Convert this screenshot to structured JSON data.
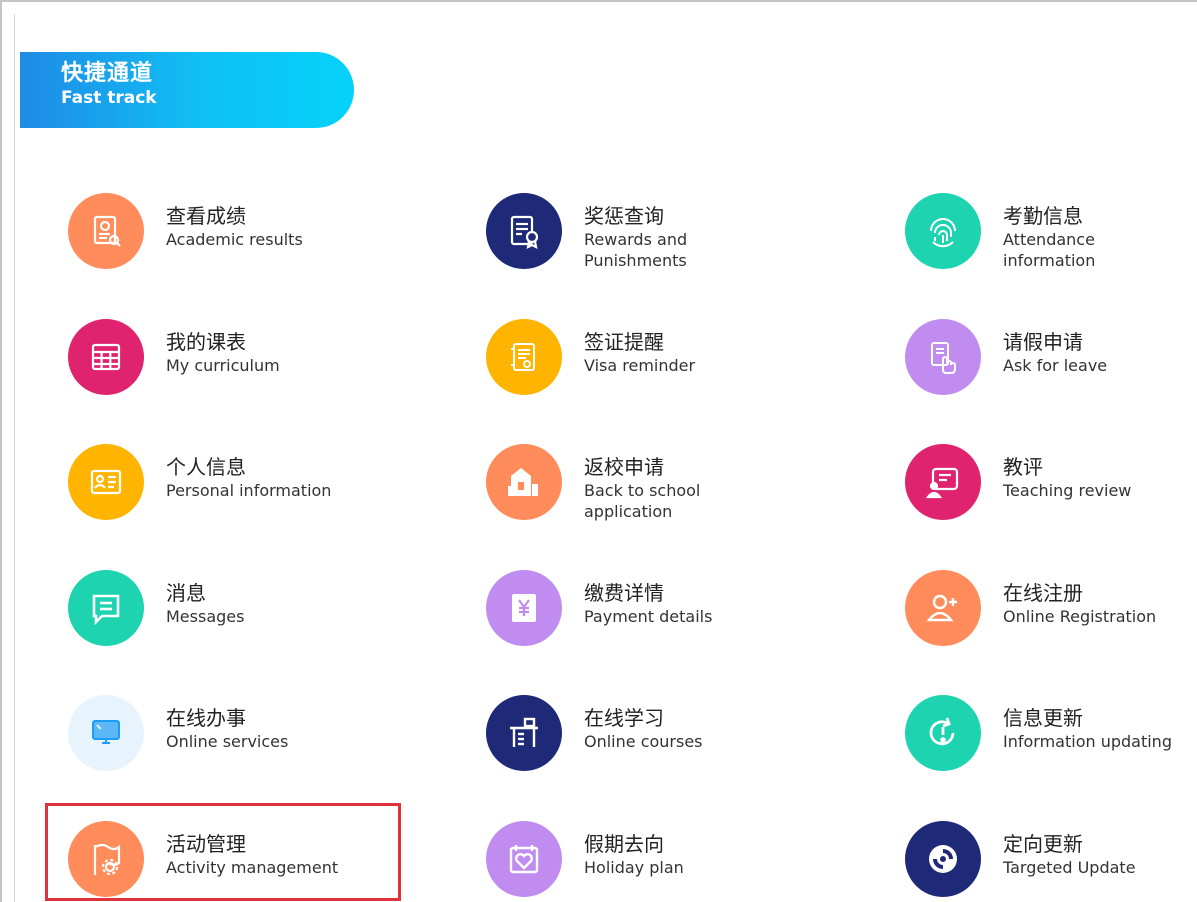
{
  "banner": {
    "title_zh": "快捷通道",
    "title_en": "Fast track",
    "gradient_from": "#1f8be6",
    "gradient_to": "#05d2fb"
  },
  "tiles": [
    {
      "zh": "查看成绩",
      "en": "Academic results",
      "icon": "grade-report-icon",
      "color": "#ff8c5a"
    },
    {
      "zh": "奖惩查询",
      "en": "Rewards and\nPunishments",
      "icon": "certificate-icon",
      "color": "#1e2a78"
    },
    {
      "zh": "考勤信息",
      "en": "Attendance\ninformation",
      "icon": "fingerprint-icon",
      "color": "#1dd3b0"
    },
    {
      "zh": "我的课表",
      "en": "My curriculum",
      "icon": "timetable-icon",
      "color": "#e0236f"
    },
    {
      "zh": "签证提醒",
      "en": "Visa reminder",
      "icon": "visa-document-icon",
      "color": "#ffb400"
    },
    {
      "zh": "请假申请",
      "en": "Ask for leave",
      "icon": "leave-request-icon",
      "color": "#c08cf0"
    },
    {
      "zh": "个人信息",
      "en": "Personal information",
      "icon": "id-card-icon",
      "color": "#ffb400"
    },
    {
      "zh": "返校申请",
      "en": "Back to school\napplication",
      "icon": "school-building-icon",
      "color": "#ff8c5a"
    },
    {
      "zh": "教评",
      "en": "Teaching review",
      "icon": "teacher-board-icon",
      "color": "#e0236f"
    },
    {
      "zh": "消息",
      "en": "Messages",
      "icon": "message-icon",
      "color": "#1dd3b0"
    },
    {
      "zh": "缴费详情",
      "en": "Payment details",
      "icon": "payment-yuan-icon",
      "color": "#c08cf0"
    },
    {
      "zh": "在线注册",
      "en": "Online Registration",
      "icon": "add-user-icon",
      "color": "#ff8c5a"
    },
    {
      "zh": "在线办事",
      "en": "Online services",
      "icon": "monitor-icon",
      "color": "#e8f4fd"
    },
    {
      "zh": "在线学习",
      "en": "Online courses",
      "icon": "desk-study-icon",
      "color": "#1e2a78"
    },
    {
      "zh": "信息更新",
      "en": "Information updating",
      "icon": "info-refresh-icon",
      "color": "#1dd3b0"
    },
    {
      "zh": "活动管理",
      "en": "Activity management",
      "icon": "flag-gear-icon",
      "color": "#ff8c5a"
    },
    {
      "zh": "假期去向",
      "en": "Holiday plan",
      "icon": "calendar-heart-icon",
      "color": "#c08cf0"
    },
    {
      "zh": "定向更新",
      "en": "Targeted Update",
      "icon": "targeted-sync-icon",
      "color": "#1e2a78"
    }
  ],
  "highlight_color": "#e0323a"
}
